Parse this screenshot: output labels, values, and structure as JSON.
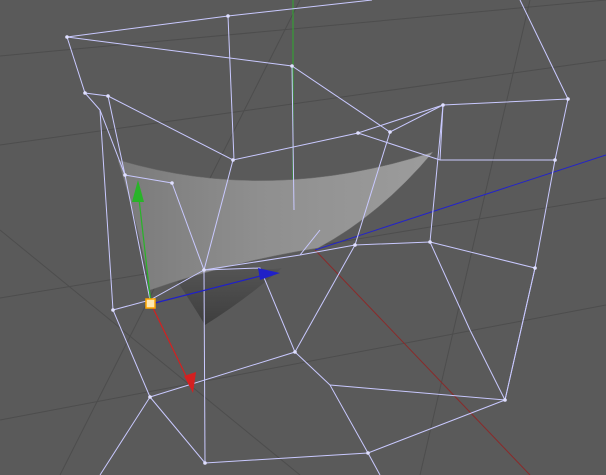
{
  "viewport": {
    "background": "#5a5a5a",
    "grid_color": "#4d4d4d",
    "cage_color": "#c9c9ff",
    "world_axes": {
      "x": "#8a2a2a",
      "y": "#2faa2f",
      "z": "#2424c8"
    },
    "gizmo": {
      "x": "#d42020",
      "y": "#28b428",
      "z": "#2020c8",
      "handle": "#ffa500"
    }
  },
  "icons": {
    "gizmo_x": "gizmo-x-arrow-icon",
    "gizmo_y": "gizmo-y-arrow-icon",
    "gizmo_z": "gizmo-z-arrow-icon",
    "gizmo_origin": "gizmo-origin-handle-icon"
  }
}
